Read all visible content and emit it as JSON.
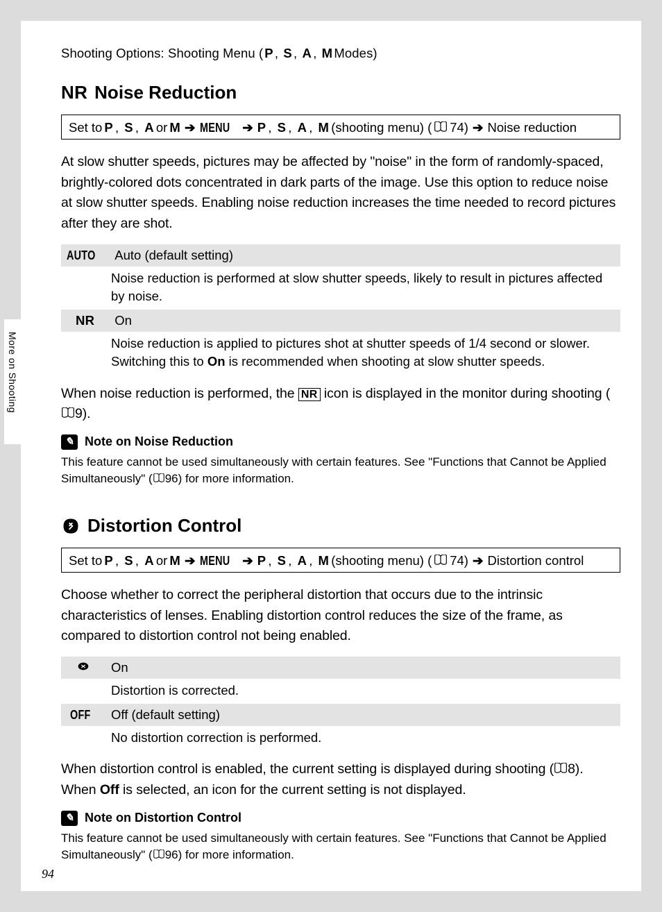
{
  "header": {
    "title_a": "Shooting Options: Shooting Menu (",
    "modes": [
      "P",
      "S",
      "A",
      "M"
    ],
    "title_b": " Modes)"
  },
  "sidebar_label": "More on Shooting",
  "page_number": "94",
  "sections": {
    "nr": {
      "icon": "NR",
      "title": "Noise Reduction",
      "nav": {
        "prefix": "Set to ",
        "modes_a": [
          "P",
          "S",
          "A"
        ],
        "or": " or ",
        "mode_last": "M",
        "menu_word": "MENU",
        "modes_b": [
          "P",
          "S",
          "A",
          "M"
        ],
        "shoot_menu": " (shooting menu) (",
        "ref": "74) ",
        "dest": " Noise reduction"
      },
      "intro": "At slow shutter speeds, pictures may be affected by \"noise\" in the form of randomly-spaced, brightly-colored dots concentrated in dark parts of the image. Use this option to reduce noise at slow shutter speeds. Enabling noise reduction increases the time needed to record pictures after they are shot.",
      "options": [
        {
          "icon": "AUTO",
          "label": "Auto (default setting)",
          "desc": "Noise reduction is performed at slow shutter speeds, likely to result in pictures affected by noise."
        },
        {
          "icon": "NR",
          "label": "On",
          "desc_a": "Noise reduction is applied to pictures shot at shutter speeds of 1/4 second or slower. Switching this to ",
          "desc_bold": "On",
          "desc_b": " is recommended when shooting at slow shutter speeds."
        }
      ],
      "after_a": "When noise reduction is performed, the ",
      "after_icon": "NR",
      "after_b": " icon is displayed in the monitor during shooting (",
      "after_ref": "9).",
      "note_title": "Note on Noise Reduction",
      "note_body_a": "This feature cannot be used simultaneously with certain features. See \"Functions that Cannot be Applied Simultaneously\" (",
      "note_ref": "96) for more information."
    },
    "dc": {
      "title": "Distortion Control",
      "nav": {
        "prefix": "Set to ",
        "modes_a": [
          "P",
          "S",
          "A"
        ],
        "or": " or ",
        "mode_last": "M",
        "menu_word": "MENU",
        "modes_b": [
          "P",
          "S",
          "A",
          "M"
        ],
        "shoot_menu": " (shooting menu) (",
        "ref": "74) ",
        "dest": " Distortion control"
      },
      "intro": "Choose whether to correct the peripheral distortion that occurs due to the intrinsic characteristics of lenses. Enabling distortion control reduces the size of the frame, as compared to distortion control not being enabled.",
      "options": [
        {
          "icon": "◆",
          "label": "On",
          "desc": "Distortion is corrected."
        },
        {
          "icon": "OFF",
          "label": "Off (default setting)",
          "desc": "No distortion correction is performed."
        }
      ],
      "after_a": "When distortion control is enabled, the current setting is displayed during shooting (",
      "after_ref": "8). When ",
      "after_bold": "Off",
      "after_b": " is selected, an icon for the current setting is not displayed.",
      "note_title": "Note on Distortion Control",
      "note_body_a": "This feature cannot be used simultaneously with certain features. See \"Functions that Cannot be Applied Simultaneously\" (",
      "note_ref": "96) for more information."
    }
  }
}
